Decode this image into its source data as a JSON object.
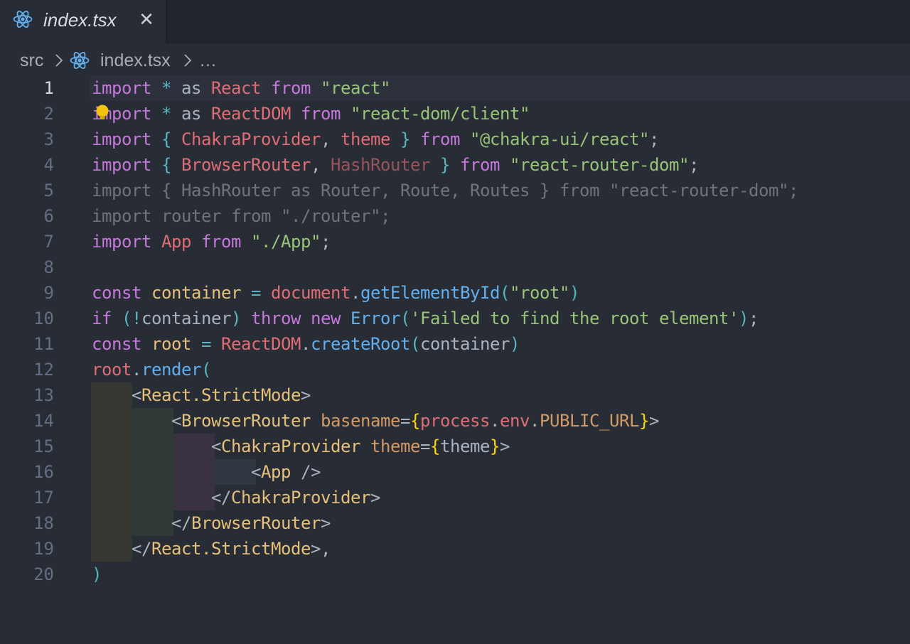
{
  "tab": {
    "label": "index.tsx",
    "close_glyph": "✕",
    "icon": "react-icon"
  },
  "breadcrumb": {
    "folder": "src",
    "file": "index.tsx",
    "more": "…"
  },
  "editor": {
    "active_line": 1,
    "line_numbers": [
      "1",
      "2",
      "3",
      "4",
      "5",
      "6",
      "7",
      "8",
      "9",
      "10",
      "11",
      "12",
      "13",
      "14",
      "15",
      "16",
      "17",
      "18",
      "19",
      "20"
    ],
    "lines": [
      [
        {
          "t": "import",
          "c": "k"
        },
        {
          "t": " ",
          "c": "w"
        },
        {
          "t": "*",
          "c": "o"
        },
        {
          "t": " as ",
          "c": "w"
        },
        {
          "t": "React",
          "c": "r"
        },
        {
          "t": " ",
          "c": "w"
        },
        {
          "t": "from",
          "c": "k"
        },
        {
          "t": " ",
          "c": "w"
        },
        {
          "t": "\"react\"",
          "c": "s"
        }
      ],
      [
        {
          "t": "import",
          "c": "k"
        },
        {
          "t": " ",
          "c": "w"
        },
        {
          "t": "*",
          "c": "o"
        },
        {
          "t": " as ",
          "c": "w"
        },
        {
          "t": "ReactDOM",
          "c": "r"
        },
        {
          "t": " ",
          "c": "w"
        },
        {
          "t": "from",
          "c": "k"
        },
        {
          "t": " ",
          "c": "w"
        },
        {
          "t": "\"react-dom/client\"",
          "c": "s"
        }
      ],
      [
        {
          "t": "import",
          "c": "k"
        },
        {
          "t": " ",
          "c": "w"
        },
        {
          "t": "{",
          "c": "p1"
        },
        {
          "t": " ",
          "c": "w"
        },
        {
          "t": "ChakraProvider",
          "c": "r"
        },
        {
          "t": ", ",
          "c": "w"
        },
        {
          "t": "theme",
          "c": "r"
        },
        {
          "t": " ",
          "c": "w"
        },
        {
          "t": "}",
          "c": "p1"
        },
        {
          "t": " ",
          "c": "w"
        },
        {
          "t": "from",
          "c": "k"
        },
        {
          "t": " ",
          "c": "w"
        },
        {
          "t": "\"@chakra-ui/react\"",
          "c": "s"
        },
        {
          "t": ";",
          "c": "w"
        }
      ],
      [
        {
          "t": "import",
          "c": "k"
        },
        {
          "t": " ",
          "c": "w"
        },
        {
          "t": "{",
          "c": "p1"
        },
        {
          "t": " ",
          "c": "w"
        },
        {
          "t": "BrowserRouter",
          "c": "r"
        },
        {
          "t": ", ",
          "c": "w"
        },
        {
          "t": "HashRouter",
          "c": "r dim"
        },
        {
          "t": " ",
          "c": "w"
        },
        {
          "t": "}",
          "c": "p1"
        },
        {
          "t": " ",
          "c": "w"
        },
        {
          "t": "from",
          "c": "k"
        },
        {
          "t": " ",
          "c": "w"
        },
        {
          "t": "\"react-router-dom\"",
          "c": "s"
        },
        {
          "t": ";",
          "c": "w"
        }
      ],
      [
        {
          "t": "import { HashRouter as Router, Route, Routes } from \"react-router-dom\";",
          "c": "dimline"
        }
      ],
      [
        {
          "t": "import router from \"./router\";",
          "c": "dimline"
        }
      ],
      [
        {
          "t": "import",
          "c": "k"
        },
        {
          "t": " ",
          "c": "w"
        },
        {
          "t": "App",
          "c": "r"
        },
        {
          "t": " ",
          "c": "w"
        },
        {
          "t": "from",
          "c": "k"
        },
        {
          "t": " ",
          "c": "w"
        },
        {
          "t": "\"./App\"",
          "c": "s"
        },
        {
          "t": ";",
          "c": "w"
        }
      ],
      [],
      [
        {
          "t": "const",
          "c": "k"
        },
        {
          "t": " ",
          "c": "w"
        },
        {
          "t": "container",
          "c": "y"
        },
        {
          "t": " ",
          "c": "w"
        },
        {
          "t": "=",
          "c": "o"
        },
        {
          "t": " ",
          "c": "w"
        },
        {
          "t": "document",
          "c": "r"
        },
        {
          "t": ".",
          "c": "w"
        },
        {
          "t": "getElementById",
          "c": "b"
        },
        {
          "t": "(",
          "c": "p1"
        },
        {
          "t": "\"root\"",
          "c": "s"
        },
        {
          "t": ")",
          "c": "p1"
        }
      ],
      [
        {
          "t": "if",
          "c": "k"
        },
        {
          "t": " ",
          "c": "w"
        },
        {
          "t": "(",
          "c": "p1"
        },
        {
          "t": "!",
          "c": "o"
        },
        {
          "t": "container",
          "c": "w"
        },
        {
          "t": ")",
          "c": "p1"
        },
        {
          "t": " ",
          "c": "w"
        },
        {
          "t": "throw",
          "c": "k"
        },
        {
          "t": " ",
          "c": "w"
        },
        {
          "t": "new",
          "c": "k"
        },
        {
          "t": " ",
          "c": "w"
        },
        {
          "t": "Error",
          "c": "b"
        },
        {
          "t": "(",
          "c": "p1"
        },
        {
          "t": "'Failed to find the root element'",
          "c": "s"
        },
        {
          "t": ")",
          "c": "p1"
        },
        {
          "t": ";",
          "c": "w"
        }
      ],
      [
        {
          "t": "const",
          "c": "k"
        },
        {
          "t": " ",
          "c": "w"
        },
        {
          "t": "root",
          "c": "y"
        },
        {
          "t": " ",
          "c": "w"
        },
        {
          "t": "=",
          "c": "o"
        },
        {
          "t": " ",
          "c": "w"
        },
        {
          "t": "ReactDOM",
          "c": "r"
        },
        {
          "t": ".",
          "c": "w"
        },
        {
          "t": "createRoot",
          "c": "b"
        },
        {
          "t": "(",
          "c": "p1"
        },
        {
          "t": "container",
          "c": "w"
        },
        {
          "t": ")",
          "c": "p1"
        }
      ],
      [
        {
          "t": "root",
          "c": "r"
        },
        {
          "t": ".",
          "c": "w"
        },
        {
          "t": "render",
          "c": "b"
        },
        {
          "t": "(",
          "c": "p1"
        }
      ],
      [
        {
          "t": "    ",
          "c": "w"
        },
        {
          "t": "<",
          "c": "w"
        },
        {
          "t": "React.StrictMode",
          "c": "y"
        },
        {
          "t": ">",
          "c": "w"
        }
      ],
      [
        {
          "t": "        ",
          "c": "w"
        },
        {
          "t": "<",
          "c": "w"
        },
        {
          "t": "BrowserRouter",
          "c": "y"
        },
        {
          "t": " ",
          "c": "w"
        },
        {
          "t": "basename",
          "c": "a"
        },
        {
          "t": "=",
          "c": "w"
        },
        {
          "t": "{",
          "c": "g"
        },
        {
          "t": "process",
          "c": "r"
        },
        {
          "t": ".",
          "c": "w"
        },
        {
          "t": "env",
          "c": "r"
        },
        {
          "t": ".",
          "c": "w"
        },
        {
          "t": "PUBLIC_URL",
          "c": "a"
        },
        {
          "t": "}",
          "c": "g"
        },
        {
          "t": ">",
          "c": "w"
        }
      ],
      [
        {
          "t": "            ",
          "c": "w"
        },
        {
          "t": "<",
          "c": "w"
        },
        {
          "t": "ChakraProvider",
          "c": "y"
        },
        {
          "t": " ",
          "c": "w"
        },
        {
          "t": "theme",
          "c": "a"
        },
        {
          "t": "=",
          "c": "w"
        },
        {
          "t": "{",
          "c": "g"
        },
        {
          "t": "theme",
          "c": "w"
        },
        {
          "t": "}",
          "c": "g"
        },
        {
          "t": ">",
          "c": "w"
        }
      ],
      [
        {
          "t": "                ",
          "c": "w"
        },
        {
          "t": "<",
          "c": "w"
        },
        {
          "t": "App",
          "c": "y"
        },
        {
          "t": " />",
          "c": "w"
        }
      ],
      [
        {
          "t": "            ",
          "c": "w"
        },
        {
          "t": "</",
          "c": "w"
        },
        {
          "t": "ChakraProvider",
          "c": "y"
        },
        {
          "t": ">",
          "c": "w"
        }
      ],
      [
        {
          "t": "        ",
          "c": "w"
        },
        {
          "t": "</",
          "c": "w"
        },
        {
          "t": "BrowserRouter",
          "c": "y"
        },
        {
          "t": ">",
          "c": "w"
        }
      ],
      [
        {
          "t": "    ",
          "c": "w"
        },
        {
          "t": "</",
          "c": "w"
        },
        {
          "t": "React.StrictMode",
          "c": "y"
        },
        {
          "t": ">,",
          "c": "w"
        }
      ],
      [
        {
          "t": ")",
          "c": "p1"
        }
      ]
    ]
  },
  "colors": {
    "background": "#282c34",
    "keyword": "#c678dd",
    "variable": "#e06c75",
    "string": "#98c379",
    "function": "#61afef",
    "tag": "#e5c07b",
    "attribute": "#d19a66"
  }
}
